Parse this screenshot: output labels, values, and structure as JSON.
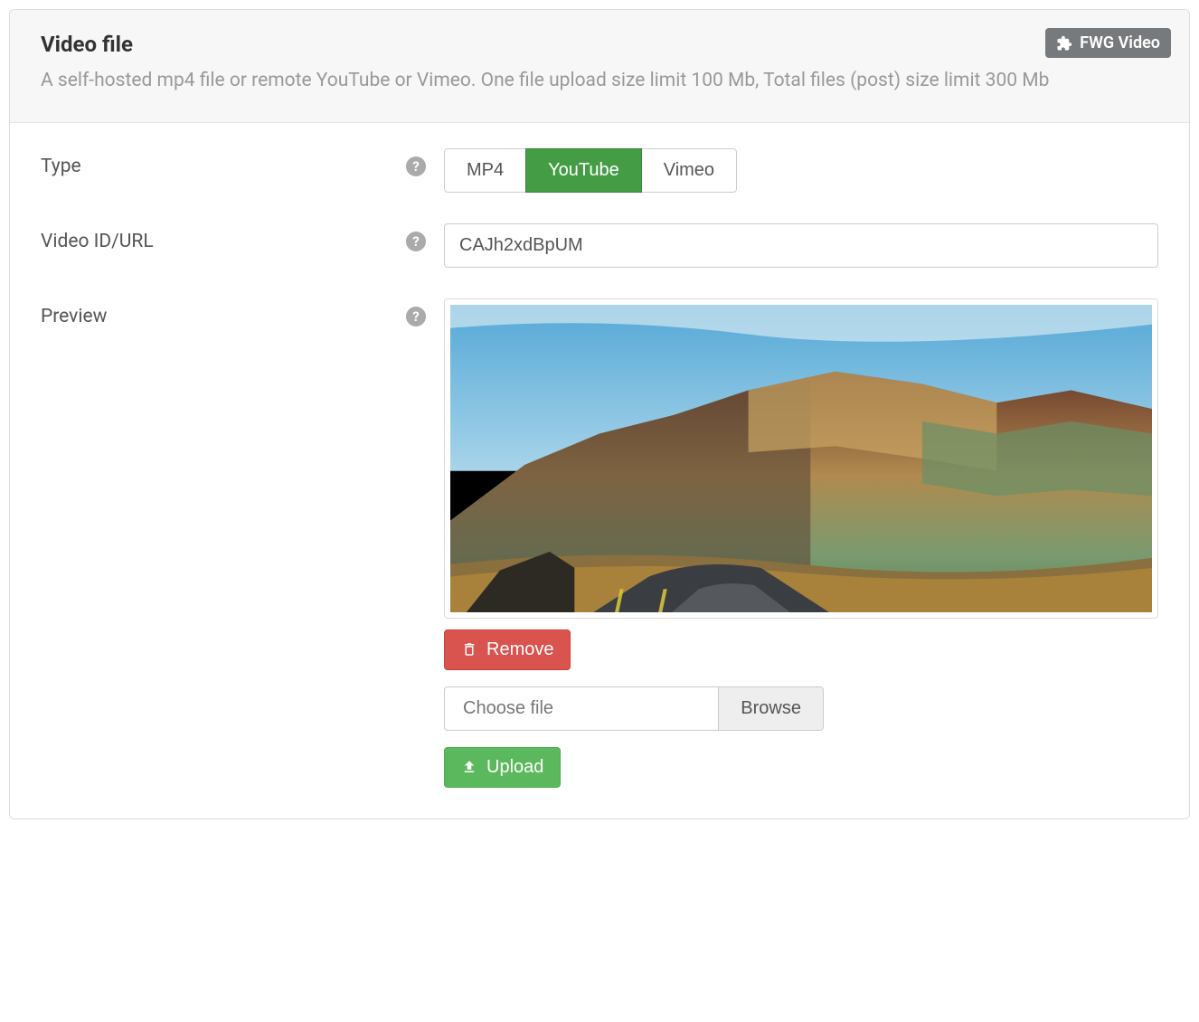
{
  "header": {
    "title": "Video file",
    "description": "A self-hosted mp4 file or remote YouTube or Vimeo. One file upload size limit 100 Mb, Total files (post) size limit 300 Mb",
    "badge_label": "FWG Video"
  },
  "form": {
    "type": {
      "label": "Type",
      "options": [
        "MP4",
        "YouTube",
        "Vimeo"
      ],
      "selected": "YouTube"
    },
    "video_id": {
      "label": "Video ID/URL",
      "value": "CAJh2xdBpUM"
    },
    "preview": {
      "label": "Preview",
      "remove_label": "Remove",
      "file_placeholder": "Choose file",
      "browse_label": "Browse",
      "upload_label": "Upload"
    }
  },
  "colors": {
    "success": "#5cb85c",
    "success_active": "#449d44",
    "danger": "#d9534f",
    "badge": "#777a7c",
    "muted": "#999"
  }
}
